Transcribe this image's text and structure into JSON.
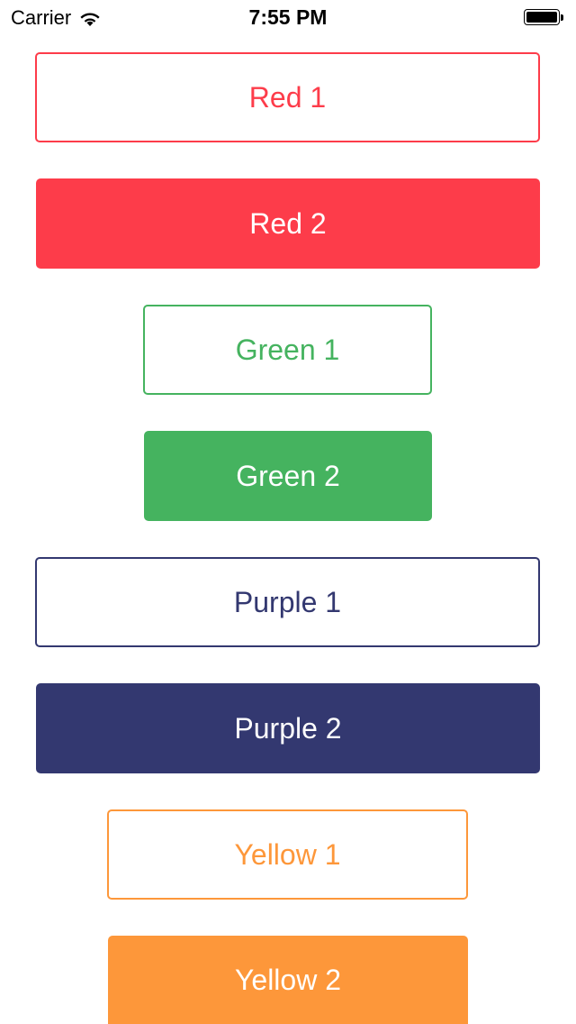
{
  "status_bar": {
    "carrier": "Carrier",
    "time": "7:55 PM",
    "wifi_icon": "wifi-icon",
    "battery_icon": "battery-icon"
  },
  "buttons": {
    "red_1": "Red 1",
    "red_2": "Red 2",
    "green_1": "Green 1",
    "green_2": "Green 2",
    "purple_1": "Purple 1",
    "purple_2": "Purple 2",
    "yellow_1": "Yellow 1",
    "yellow_2": "Yellow 2"
  },
  "colors": {
    "red": "#fd3c4a",
    "green": "#45b35f",
    "purple": "#333870",
    "yellow": "#fd973a"
  }
}
